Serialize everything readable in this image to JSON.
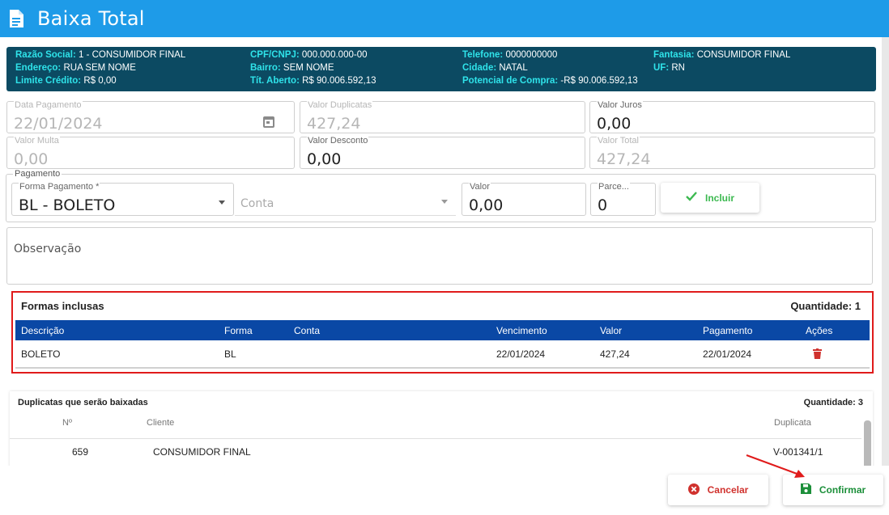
{
  "window": {
    "title": "Baixa Total",
    "title_icon": "document-icon"
  },
  "client_info": {
    "razao_social_label": "Razão Social:",
    "razao_social": "1 - CONSUMIDOR FINAL",
    "endereco_label": "Endereço:",
    "endereco": "RUA SEM NOME",
    "limite_label": "Limite Crédito:",
    "limite": "R$ 0,00",
    "cpf_label": "CPF/CNPJ:",
    "cpf": "000.000.000-00",
    "bairro_label": "Bairro:",
    "bairro": "SEM NOME",
    "tft_label": "Tít. Aberto:",
    "tft": "R$ 90.006.592,13",
    "telefone_label": "Telefone:",
    "telefone": "0000000000",
    "cidade_label": "Cidade:",
    "cidade": "NATAL",
    "potencial_label": "Potencial de Compra:",
    "potencial": "-R$ 90.006.592,13",
    "fantasia_label": "Fantasia:",
    "fantasia": "CONSUMIDOR FINAL",
    "uf_label": "UF:",
    "uf": "RN"
  },
  "fields": {
    "data_pagamento": {
      "label": "Data Pagamento",
      "value": "22/01/2024"
    },
    "valor_duplicatas": {
      "label": "Valor Duplicatas",
      "value": "427,24"
    },
    "valor_juros": {
      "label": "Valor Juros",
      "value": "0,00"
    },
    "valor_multa": {
      "label": "Valor Multa",
      "value": "0,00"
    },
    "valor_desconto": {
      "label": "Valor Desconto",
      "value": "0,00"
    },
    "valor_total": {
      "label": "Valor Total",
      "value": "427,24"
    }
  },
  "pagamento": {
    "group_label": "Pagamento",
    "forma_label": "Forma Pagamento *",
    "forma_value": "BL - BOLETO",
    "conta_placeholder": "Conta",
    "valor_label": "Valor",
    "valor_value": "0,00",
    "parcelas_label": "Parce...",
    "parcelas_value": "0",
    "incluir_label": "Incluir"
  },
  "observacao": {
    "placeholder": "Observação"
  },
  "formas_inclusas": {
    "title": "Formas inclusas",
    "quantidade": "Quantidade: 1",
    "columns": [
      "Descrição",
      "Forma",
      "Conta",
      "Vencimento",
      "Valor",
      "Pagamento",
      "Ações"
    ],
    "rows": [
      {
        "descricao": "BOLETO",
        "forma": "BL",
        "conta": "",
        "vencimento": "22/01/2024",
        "valor": "427,24",
        "pagamento": "22/01/2024"
      }
    ]
  },
  "duplicatas": {
    "title": "Duplicatas que serão baixadas",
    "quantidade": "Quantidade: 3",
    "columns": [
      "Nº",
      "Cliente",
      "Duplicata"
    ],
    "rows": [
      {
        "numero": "659",
        "cliente": "CONSUMIDOR FINAL",
        "duplicata": "V-001341/1"
      }
    ]
  },
  "footer": {
    "cancelar_label": "Cancelar",
    "confirmar_label": "Confirmar"
  },
  "colors": {
    "header": "#1e9be8",
    "info_bg": "#0c4a62",
    "table_header": "#0a48a5",
    "highlight": "#e01b1b",
    "success": "#3cb950",
    "danger": "#d0312d"
  }
}
